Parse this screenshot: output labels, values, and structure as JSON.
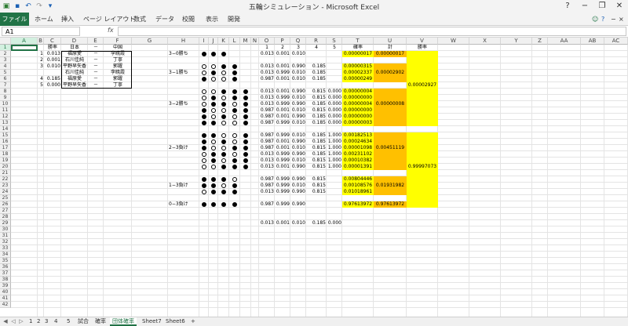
{
  "window": {
    "title": "五輪シミュレーション - Microsoft Excel",
    "controls": [
      "?",
      "−",
      "❐",
      "✕"
    ]
  },
  "ribbon": {
    "file_label": "ファイル",
    "tabs": [
      "ホーム",
      "挿入",
      "ページ レイアウト",
      "数式",
      "データ",
      "校閲",
      "表示",
      "開発"
    ]
  },
  "formula_bar": {
    "name_box": "A1",
    "fx": "fx",
    "value": ""
  },
  "columns": [
    "A",
    "B",
    "C",
    "D",
    "E",
    "F",
    "G",
    "H",
    "I",
    "J",
    "K",
    "L",
    "M",
    "N",
    "O",
    "P",
    "Q",
    "R",
    "S",
    "T",
    "U",
    "V",
    "W",
    "X",
    "Y",
    "Z",
    "AA",
    "AB",
    "AC"
  ],
  "rows": [
    "1",
    "2",
    "3",
    "4",
    "5",
    "6",
    "7",
    "8",
    "9",
    "10",
    "11",
    "12",
    "13",
    "14",
    "15",
    "16",
    "17",
    "18",
    "19",
    "20",
    "21",
    "22",
    "23",
    "24",
    "25",
    "26",
    "27",
    "28",
    "29",
    "30",
    "31",
    "32",
    "33",
    "34",
    "35",
    "36",
    "37",
    "38",
    "39",
    "40",
    "41",
    "42"
  ],
  "players": {
    "header": {
      "rate": "勝率",
      "left": "日本",
      "dash": "－",
      "right": "中国"
    },
    "rows": [
      {
        "no": "1",
        "rate": "0.013",
        "left": "福原愛",
        "dash": "－",
        "right": "李暁霞"
      },
      {
        "no": "2",
        "rate": "0.001",
        "left": "石川佳純",
        "dash": "－",
        "right": "丁寧"
      },
      {
        "no": "3",
        "rate": "0.010",
        "left": "平野早矢香",
        "dash": "－",
        "right": "郭躍"
      },
      {
        "no": "",
        "rate": "",
        "left": "石川佳純",
        "dash": "－",
        "right": "李暁霞"
      },
      {
        "no": "4",
        "rate": "0.185",
        "left": "福原愛",
        "dash": "－",
        "right": "郭躍"
      },
      {
        "no": "5",
        "rate": "0.000",
        "left": "平野早矢香",
        "dash": "－",
        "right": "丁寧"
      }
    ]
  },
  "sim": {
    "col_numbers": [
      "1",
      "2",
      "3",
      "4",
      "5"
    ],
    "prob_header": "確率",
    "sum_header": "計",
    "win_header": "勝率",
    "groups": [
      {
        "label": "3−0勝ち",
        "subtotal": "0.00000017"
      },
      {
        "label": "3−1勝ち",
        "subtotal": "0.00002902"
      },
      {
        "label": "3−2勝ち",
        "subtotal": "0.00000008"
      },
      {
        "label": "2−3負け",
        "subtotal": "0.00451119"
      },
      {
        "label": "1−3負け",
        "subtotal": "0.01931982"
      },
      {
        "label": "0−3負け",
        "subtotal": "0.97613972"
      }
    ],
    "win_total": "0.00002927",
    "lose_total": "0.99997073",
    "lines": [
      {
        "row": 2,
        "vals": [
          "0.013",
          "0.001",
          "0.010",
          "",
          ""
        ],
        "prob": "0.00000017",
        "marks": "bbb"
      },
      {
        "row": 4,
        "vals": [
          "0.013",
          "0.001",
          "0.990",
          "0.185",
          ""
        ],
        "prob": "0.00000315",
        "marks": "wwbb"
      },
      {
        "row": 5,
        "vals": [
          "0.013",
          "0.999",
          "0.010",
          "0.185",
          ""
        ],
        "prob": "0.00002337",
        "marks": "wbwb"
      },
      {
        "row": 6,
        "vals": [
          "0.987",
          "0.001",
          "0.010",
          "0.185",
          ""
        ],
        "prob": "0.00000249",
        "marks": "bwwb"
      },
      {
        "row": 8,
        "vals": [
          "0.013",
          "0.001",
          "0.990",
          "0.815",
          "0.000"
        ],
        "prob": "0.00000004",
        "marks": "wwbbb"
      },
      {
        "row": 9,
        "vals": [
          "0.013",
          "0.999",
          "0.010",
          "0.815",
          "0.000"
        ],
        "prob": "0.00000000",
        "marks": "wbwbb"
      },
      {
        "row": 10,
        "vals": [
          "0.013",
          "0.999",
          "0.990",
          "0.185",
          "0.000"
        ],
        "prob": "0.00000004",
        "marks": "wbbwb"
      },
      {
        "row": 11,
        "vals": [
          "0.987",
          "0.001",
          "0.010",
          "0.815",
          "0.000"
        ],
        "prob": "0.00000000",
        "marks": "bwwbb"
      },
      {
        "row": 12,
        "vals": [
          "0.987",
          "0.001",
          "0.990",
          "0.185",
          "0.000"
        ],
        "prob": "0.00000000",
        "marks": "bwbwb"
      },
      {
        "row": 13,
        "vals": [
          "0.987",
          "0.999",
          "0.010",
          "0.185",
          "0.000"
        ],
        "prob": "0.00000003",
        "marks": "bbwwb"
      },
      {
        "row": 15,
        "vals": [
          "0.987",
          "0.999",
          "0.010",
          "0.185",
          "1.000"
        ],
        "prob": "0.00182513",
        "marks": "bbwwb"
      },
      {
        "row": 16,
        "vals": [
          "0.987",
          "0.001",
          "0.990",
          "0.185",
          "1.000"
        ],
        "prob": "0.00024634",
        "marks": "bwbwb"
      },
      {
        "row": 17,
        "vals": [
          "0.987",
          "0.001",
          "0.010",
          "0.815",
          "1.000"
        ],
        "prob": "0.00001098",
        "marks": "bwwbb"
      },
      {
        "row": 18,
        "vals": [
          "0.013",
          "0.999",
          "0.990",
          "0.185",
          "1.000"
        ],
        "prob": "0.00231102",
        "marks": "wbbwb"
      },
      {
        "row": 19,
        "vals": [
          "0.013",
          "0.999",
          "0.010",
          "0.815",
          "1.000"
        ],
        "prob": "0.00010382",
        "marks": "wbwbb"
      },
      {
        "row": 20,
        "vals": [
          "0.013",
          "0.001",
          "0.990",
          "0.815",
          "1.000"
        ],
        "prob": "0.00001391",
        "marks": "wwbbb"
      },
      {
        "row": 22,
        "vals": [
          "0.987",
          "0.999",
          "0.990",
          "0.815",
          ""
        ],
        "prob": "0.00804446",
        "marks": "bbbw"
      },
      {
        "row": 23,
        "vals": [
          "0.987",
          "0.999",
          "0.010",
          "0.815",
          ""
        ],
        "prob": "0.00108576",
        "marks": "bbwb"
      },
      {
        "row": 24,
        "vals": [
          "0.013",
          "0.999",
          "0.990",
          "0.815",
          ""
        ],
        "prob": "0.01018961",
        "marks": "wbbb"
      },
      {
        "row": 26,
        "vals": [
          "0.987",
          "0.999",
          "0.990",
          "",
          ""
        ],
        "prob": "0.97613972",
        "marks": "bbbb"
      },
      {
        "row": 29,
        "vals": [
          "0.013",
          "0.001",
          "0.010",
          "0.185",
          "0.000"
        ],
        "prob": "",
        "marks": ""
      }
    ]
  },
  "sheet_tabs": [
    "1",
    "2",
    "3",
    "4",
    "5",
    "試合",
    "確率",
    "団体確率",
    "Sheet7",
    "Sheet6",
    "+"
  ],
  "active_sheet": "団体確率",
  "colors": {
    "excel_green": "#217346",
    "yellow": "#ffff00",
    "orange": "#ffc000",
    "gold": "#ffd966"
  }
}
